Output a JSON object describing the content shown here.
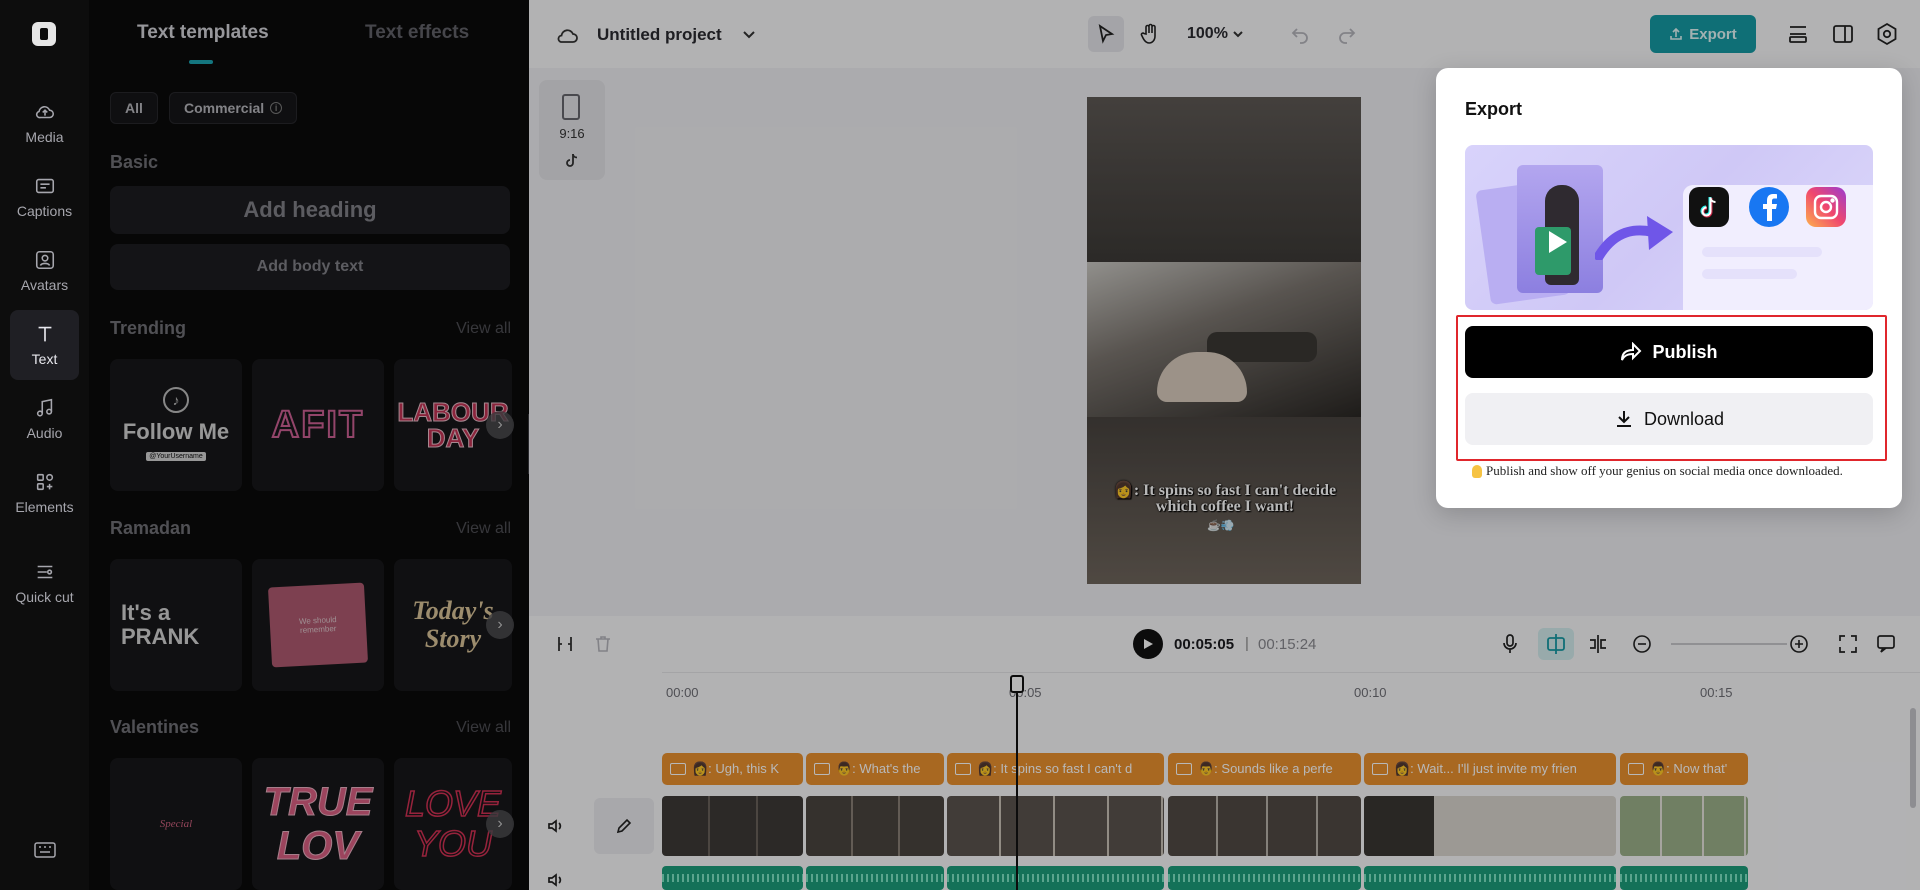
{
  "rail": {
    "items": [
      {
        "label": "Media"
      },
      {
        "label": "Captions"
      },
      {
        "label": "Avatars"
      },
      {
        "label": "Text"
      },
      {
        "label": "Audio"
      },
      {
        "label": "Elements"
      },
      {
        "label": "Quick cut"
      }
    ]
  },
  "library": {
    "tabs": [
      {
        "label": "Text templates"
      },
      {
        "label": "Text effects"
      }
    ],
    "filters": [
      {
        "label": "All"
      },
      {
        "label": "Commercial"
      }
    ],
    "basic": {
      "title": "Basic",
      "add_heading": "Add heading",
      "add_body": "Add body text"
    },
    "view_all": "View all",
    "sections": [
      {
        "title": "Trending",
        "thumbs": [
          "Follow Me",
          "AFIT",
          "LABOUR DAY"
        ],
        "thumb_sub": "@YourUsername"
      },
      {
        "title": "Ramadan",
        "thumbs": [
          "It's a PRANK",
          "We should remember",
          "Today's Story"
        ]
      },
      {
        "title": "Valentines",
        "thumbs": [
          "Special",
          "TRUE LOV",
          "LOVE YOU"
        ]
      }
    ]
  },
  "header": {
    "project_title": "Untitled project",
    "zoom": "100%",
    "export_label": "Export"
  },
  "canvas": {
    "ratio": "9:16",
    "caption": "👩: It spins so fast I can't decide which coffee I want!",
    "caption_emoji": "☕💨"
  },
  "timeline": {
    "current_time": "00:05:05",
    "separator": "|",
    "total_time": "00:15:24",
    "ruler": [
      "00:00",
      "00:05",
      "00:10",
      "00:15"
    ],
    "caption_clips": [
      "👩: Ugh, this K",
      "👨: What's the",
      "👩: It spins so fast I can't d",
      "👨: Sounds like a perfe",
      "👩: Wait... I'll just invite my frien",
      "👨: Now that'"
    ]
  },
  "export_panel": {
    "title": "Export",
    "publish_label": "Publish",
    "download_label": "Download",
    "hint": "Publish and show off your genius on social media once downloaded."
  },
  "colors": {
    "accent": "#169aa4",
    "caption_clip": "#e9902f",
    "highlight": "#e0262c"
  }
}
